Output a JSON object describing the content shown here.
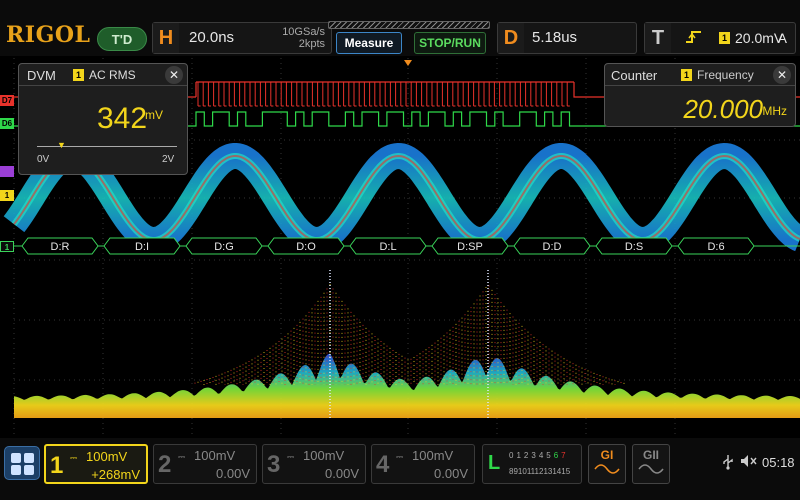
{
  "brand": "RIGOL",
  "trigger_status": "T'D",
  "horizontal": {
    "tag": "H",
    "timebase": "20.0ns",
    "sample_rate": "10GSa/s",
    "memory_depth": "2kpts"
  },
  "buttons": {
    "measure": "Measure",
    "stop_run": "STOP/RUN"
  },
  "delay": {
    "tag": "D",
    "value": "5.18us"
  },
  "trigger": {
    "tag": "T",
    "edge_icon": "rising-edge-icon",
    "source": "1",
    "level": "20.0mV",
    "mode": "A"
  },
  "dvm": {
    "title": "DVM",
    "source": "1",
    "mode": "AC RMS",
    "reading": "342",
    "unit": "mV",
    "scale_min": "0V",
    "scale_max": "2V",
    "level": 0.171
  },
  "counter": {
    "title": "Counter",
    "source": "1",
    "mode": "Frequency",
    "reading": "20.000",
    "unit": "MHz"
  },
  "channel_markers": {
    "d7": "D7",
    "d6": "D6",
    "ch1_trace": "1",
    "ch1_bus": "1"
  },
  "bus_decode": [
    "D:R",
    "D:I",
    "D:G",
    "D:O",
    "D:L",
    "D:SP",
    "D:D",
    "D:S",
    "D:6"
  ],
  "channels": [
    {
      "num": "1",
      "coupling": "DC",
      "scale": "100mV",
      "offset": "+268mV",
      "active": true
    },
    {
      "num": "2",
      "coupling": "DC",
      "scale": "100mV",
      "offset": "0.00V",
      "active": false
    },
    {
      "num": "3",
      "coupling": "DC",
      "scale": "100mV",
      "offset": "0.00V",
      "active": false
    },
    {
      "num": "4",
      "coupling": "DC",
      "scale": "100mV",
      "offset": "0.00V",
      "active": false
    }
  ],
  "logic": {
    "tag": "L",
    "row1": [
      "0",
      "1",
      "2",
      "3",
      "4",
      "5",
      "6",
      "7"
    ],
    "row2": [
      "8",
      "9",
      "10",
      "11",
      "12",
      "13",
      "14",
      "15"
    ]
  },
  "generators": {
    "g1": "GI",
    "g2": "GII"
  },
  "status": {
    "time": "05:18"
  },
  "colors": {
    "ch1": "#f2d51b",
    "d7": "#e8322b",
    "d6": "#2fd94a",
    "bus": "#3ad35a",
    "accent": "#f08c1e"
  }
}
